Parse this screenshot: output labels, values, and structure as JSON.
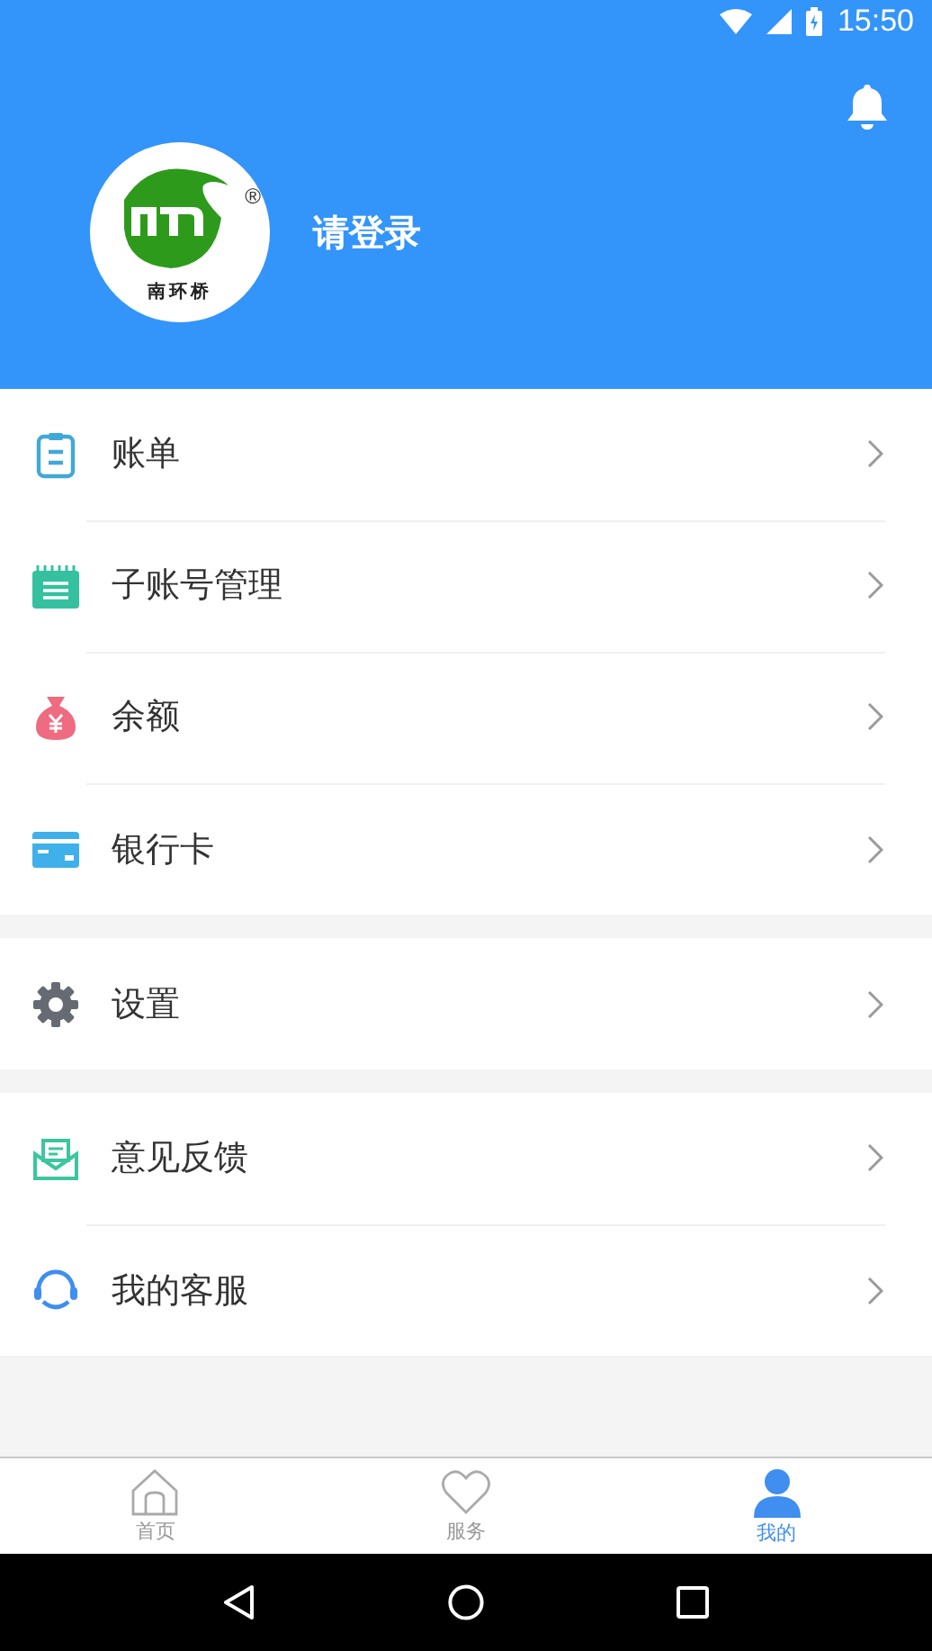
{
  "status_bar": {
    "time": "15:50"
  },
  "profile": {
    "logo": {
      "mark": "®",
      "caption": "南环桥"
    },
    "login_prompt": "请登录"
  },
  "menu_groups": [
    [
      {
        "kind": "bill",
        "label": "账单"
      },
      {
        "kind": "subaccount",
        "label": "子账号管理"
      },
      {
        "kind": "balance",
        "label": "余额"
      },
      {
        "kind": "card",
        "label": "银行卡"
      }
    ],
    [
      {
        "kind": "settings",
        "label": "设置"
      }
    ],
    [
      {
        "kind": "feedback",
        "label": "意见反馈"
      },
      {
        "kind": "service",
        "label": "我的客服"
      }
    ]
  ],
  "tabs": [
    {
      "kind": "home",
      "label": "首页",
      "selected": false
    },
    {
      "kind": "services",
      "label": "服务",
      "selected": false
    },
    {
      "kind": "mine",
      "label": "我的",
      "selected": true
    }
  ]
}
